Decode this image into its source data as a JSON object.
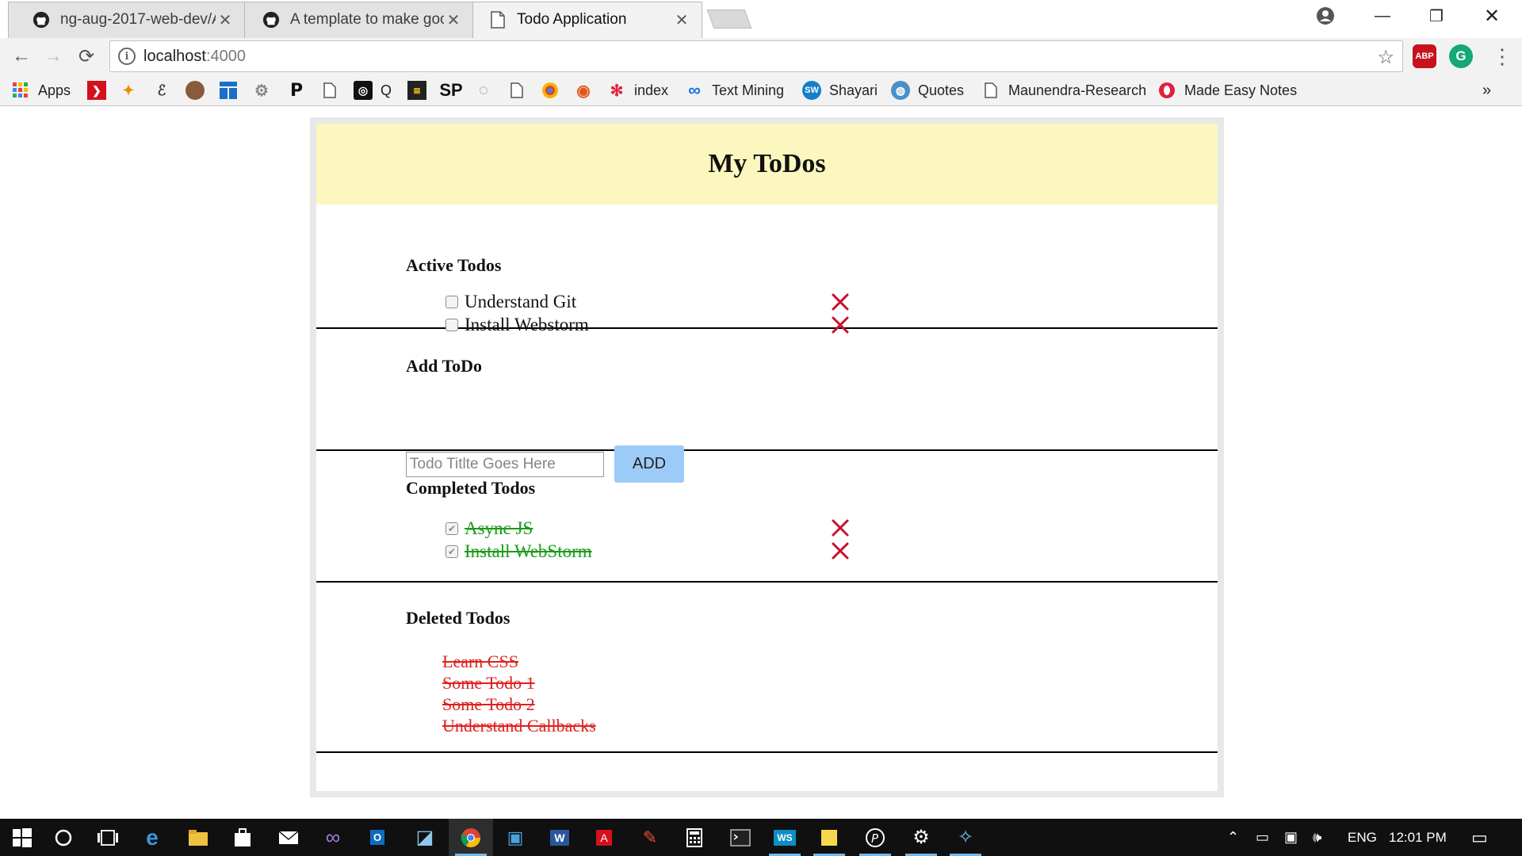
{
  "browser": {
    "tabs": [
      {
        "title": "ng-aug-2017-web-dev/A",
        "icon": "github-icon"
      },
      {
        "title": "A template to make good",
        "icon": "github-icon"
      },
      {
        "title": "Todo Application",
        "icon": "page-icon"
      }
    ],
    "url_host": "localhost",
    "url_port": ":4000",
    "extensions": [
      {
        "name": "adblock-plus-icon",
        "label": "ABP",
        "color": "#c7121b"
      },
      {
        "name": "grammarly-icon",
        "label": "G",
        "color": "#15a874"
      }
    ],
    "bookmarks": [
      {
        "label": "Apps",
        "icon": "apps-grid-icon"
      },
      {
        "label": "",
        "icon": "red-arrow-icon"
      },
      {
        "label": "",
        "icon": "fox-icon"
      },
      {
        "label": "",
        "icon": "signature-icon"
      },
      {
        "label": "",
        "icon": "avatar-icon"
      },
      {
        "label": "",
        "icon": "blue-layout-icon"
      },
      {
        "label": "",
        "icon": "gear-bookmark-icon"
      },
      {
        "label": "",
        "icon": "p-icon"
      },
      {
        "label": "",
        "icon": "page-icon"
      },
      {
        "label": "Q",
        "icon": "q-icon"
      },
      {
        "label": "",
        "icon": "terminal-icon"
      },
      {
        "label": "",
        "icon": "sp-icon",
        "glyph": "SP"
      },
      {
        "label": "",
        "icon": "loading-icon"
      },
      {
        "label": "",
        "icon": "page-icon"
      },
      {
        "label": "",
        "icon": "colorful-icon"
      },
      {
        "label": "",
        "icon": "fox-face-icon"
      },
      {
        "label": "index",
        "icon": "dots-icon"
      },
      {
        "label": "Text Mining",
        "icon": "infinity-icon"
      },
      {
        "label": "Shayari",
        "icon": "sw-icon"
      },
      {
        "label": "Quotes",
        "icon": "globe-icon"
      },
      {
        "label": "Maunendra-Research",
        "icon": "page-icon"
      },
      {
        "label": "Made Easy Notes",
        "icon": "opera-icon"
      }
    ],
    "bookmarks_overflow": "»"
  },
  "app": {
    "title": "My ToDos",
    "active": {
      "heading": "Active Todos",
      "items": [
        "Understand Git",
        "Install Webstorm"
      ]
    },
    "add": {
      "heading": "Add ToDo",
      "placeholder": "Todo Titlte Goes Here",
      "button_label": "ADD"
    },
    "completed": {
      "heading": "Completed Todos",
      "items": [
        "Async JS",
        "Install WebStorm"
      ]
    },
    "deleted": {
      "heading": "Deleted Todos",
      "items": [
        "Learn CSS",
        "Some Todo 1",
        "Some Todo 2",
        "Understand Callbacks"
      ]
    },
    "delete_color": "#c8102e"
  },
  "taskbar": {
    "language": "ENG",
    "time": "12:01 PM"
  }
}
